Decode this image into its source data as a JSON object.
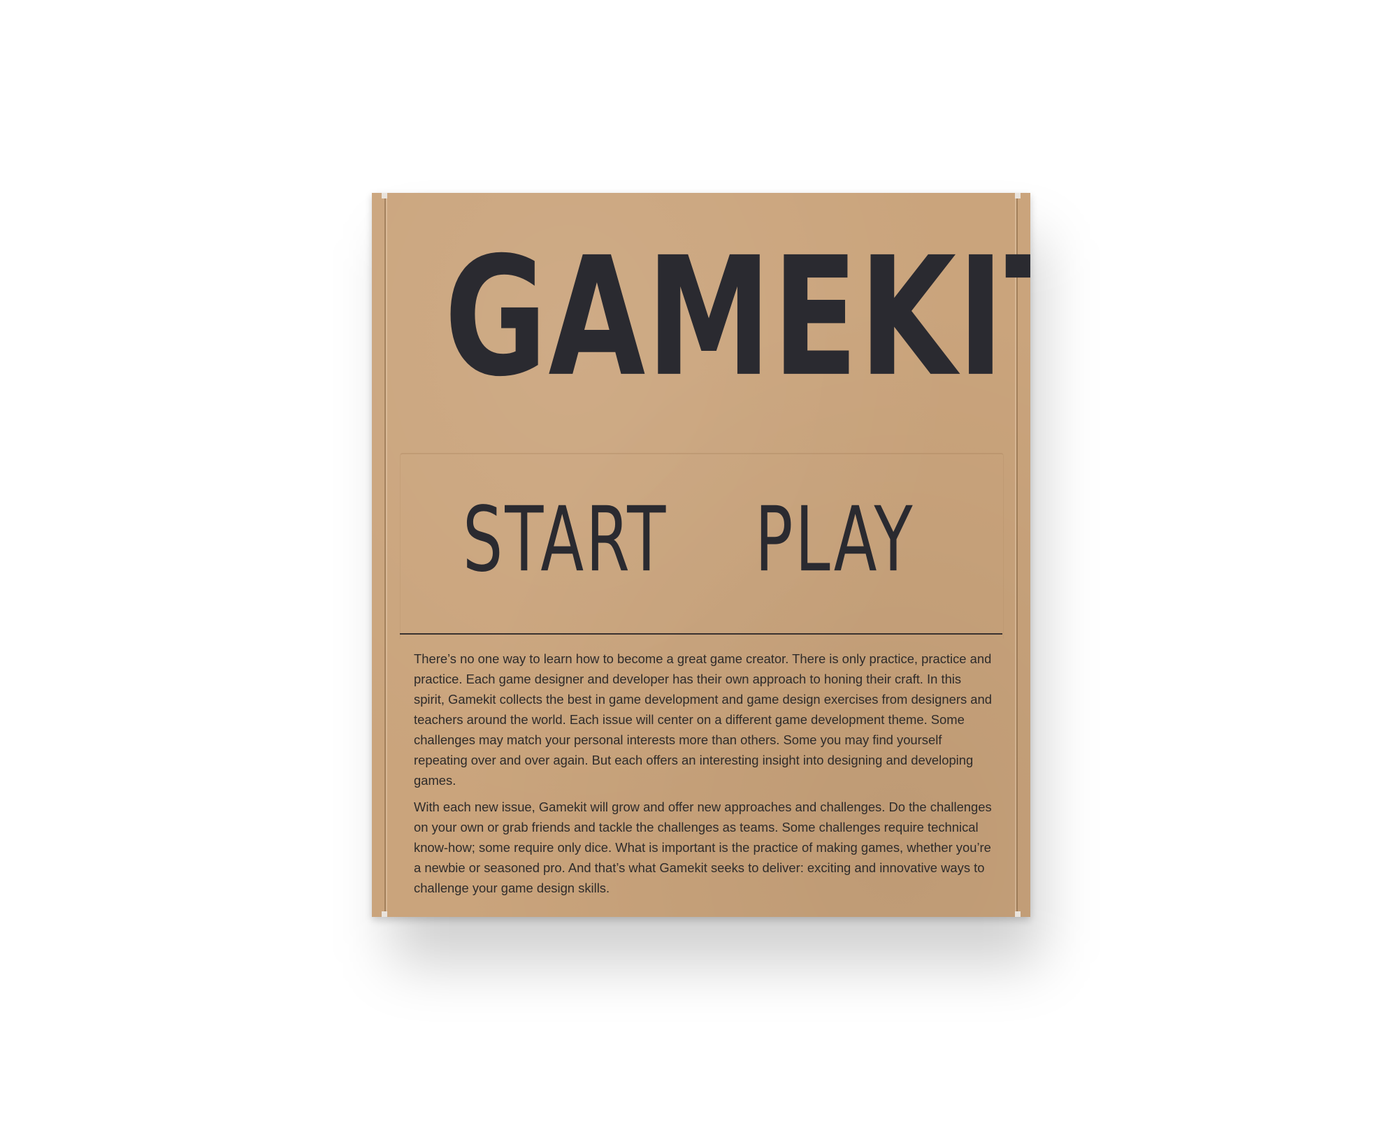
{
  "box": {
    "title": "GAMEKIT",
    "subtitle_left": "START",
    "subtitle_right": "PLAY",
    "paragraphs": [
      "There’s no one way to learn how to become a great game creator. There is only practice, practice and practice. Each game designer and developer has their own approach to honing their craft. In this spirit, Gamekit collects the best in game development and game design exercises from designers and teachers around the world. Each issue will center on a different game development theme. Some challenges may match your personal interests more than others. Some you may find yourself repeating over and over again. But each offers an interesting insight into designing and developing games.",
      "With each new issue, Gamekit will grow and offer new approaches and challenges. Do the challenges on your own or grab friends and tackle the challenges as teams. Some challenges require technical know-how; some require only dice. What is important is the practice of making games, whether you’re a newbie or seasoned pro. And that’s what Gamekit seeks to deliver: exciting and innovative ways to challenge your game design skills."
    ]
  },
  "colors": {
    "cardboard": "#caa47c",
    "ink": "#2a2a30",
    "background": "#ffffff"
  }
}
